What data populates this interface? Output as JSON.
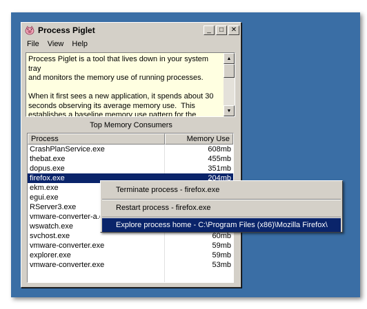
{
  "window": {
    "title": "Process Piglet"
  },
  "titlebar": {
    "minimize": "_",
    "maximize": "□",
    "close": "✕"
  },
  "menu": [
    "File",
    "View",
    "Help"
  ],
  "info_text": "Process Piglet is a tool that lives down in your system tray\nand monitors the memory use of running processes.\n\nWhen it first sees a new application, it spends about 30\nseconds observing its average memory use.  This\nestablishes a baseline memory use pattern for the",
  "section_label": "Top Memory Consumers",
  "table": {
    "columns": [
      "Process",
      "Memory Use"
    ],
    "rows": [
      {
        "name": "CrashPlanService.exe",
        "mem": "608mb"
      },
      {
        "name": "thebat.exe",
        "mem": "455mb"
      },
      {
        "name": "dopus.exe",
        "mem": "351mb"
      },
      {
        "name": "firefox.exe",
        "mem": "204mb"
      },
      {
        "name": "ekm.exe",
        "mem": ""
      },
      {
        "name": "egui.exe",
        "mem": ""
      },
      {
        "name": "RServer3.exe",
        "mem": ""
      },
      {
        "name": "vmware-converter-a.exe",
        "mem": ""
      },
      {
        "name": "wswatch.exe",
        "mem": ""
      },
      {
        "name": "svchost.exe",
        "mem": "60mb"
      },
      {
        "name": "vmware-converter.exe",
        "mem": "59mb"
      },
      {
        "name": "explorer.exe",
        "mem": "59mb"
      },
      {
        "name": "vmware-converter.exe",
        "mem": "53mb"
      }
    ],
    "selected_index": 3
  },
  "context_menu": {
    "items": [
      "Terminate process - firefox.exe",
      "Restart process - firefox.exe",
      "Explore process home - C:\\Program Files (x86)\\Mozilla Firefox\\"
    ],
    "highlighted_index": 2
  },
  "colors": {
    "desktop": "#3a6ea5",
    "window_face": "#d4d0c8",
    "selection": "#0a246a",
    "info_background": "#ffffe1"
  },
  "icons": {
    "app": "pig-icon",
    "scroll_up": "scroll-up-arrow-icon",
    "scroll_down": "scroll-down-arrow-icon"
  }
}
